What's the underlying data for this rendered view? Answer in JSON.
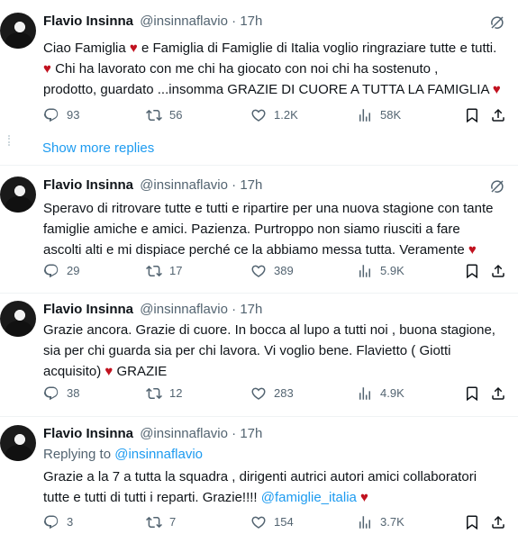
{
  "show_more_replies": "Show more replies",
  "tweets": [
    {
      "name": "Flavio Insinna",
      "handle": "@insinnaflavio",
      "separator": "·",
      "time": "17h",
      "lines": [
        "Ciao Famiglia ♥️ e Famiglia di Famiglie di Italia voglio ringraziare tutte e tutti.",
        "♥️ Chi ha lavorato con me chi ha giocato con noi chi ha sostenuto ,",
        "prodotto, guardato ...insomma GRAZIE DI CUORE A TUTTA LA FAMIGLIA ♥️"
      ],
      "replies": "93",
      "reposts": "56",
      "likes": "1.2K",
      "views": "58K"
    },
    {
      "name": "Flavio Insinna",
      "handle": "@insinnaflavio",
      "separator": "·",
      "time": "17h",
      "lines": [
        "Speravo di ritrovare tutte e tutti e ripartire per una nuova stagione con tante",
        "famiglie amiche e amici. Pazienza. Purtroppo non siamo riusciti a fare",
        "ascolti  alti e mi dispiace perché ce la abbiamo messa tutta. Veramente ♥️"
      ],
      "replies": "29",
      "reposts": "17",
      "likes": "389",
      "views": "5.9K"
    },
    {
      "name": "Flavio Insinna",
      "handle": "@insinnaflavio",
      "separator": "·",
      "time": "17h",
      "lines": [
        "Grazie ancora. Grazie di cuore. In bocca al lupo a tutti noi , buona stagione,",
        "sia per chi guarda sia per chi lavora. Vi voglio bene. Flavietto ( Giotti",
        "acquisito) ♥️ GRAZIE"
      ],
      "replies": "38",
      "reposts": "12",
      "likes": "283",
      "views": "4.9K"
    },
    {
      "name": "Flavio Insinna",
      "handle": "@insinnaflavio",
      "separator": "·",
      "time": "17h",
      "replying_prefix": "Replying to",
      "replying_to": "@insinnaflavio",
      "lines": [
        "Grazie a la 7 a tutta la squadra , dirigenti autrici autori amici collaboratori",
        "tutte e tutti di tutti i reparti. Grazie!!!! "
      ],
      "mention": "@famiglie_italia",
      "trailing_heart": "♥️",
      "replies": "3",
      "reposts": "7",
      "likes": "154",
      "views": "3.7K"
    }
  ],
  "icons": {
    "reply": "reply-icon",
    "repost": "repost-icon",
    "like": "like-icon",
    "views": "views-icon",
    "bookmark": "bookmark-icon",
    "share": "share-icon",
    "grok": "grok-icon"
  },
  "colors": {
    "accent": "#1d9bf0",
    "secondary_text": "#536471",
    "heart": "#c1121f"
  }
}
